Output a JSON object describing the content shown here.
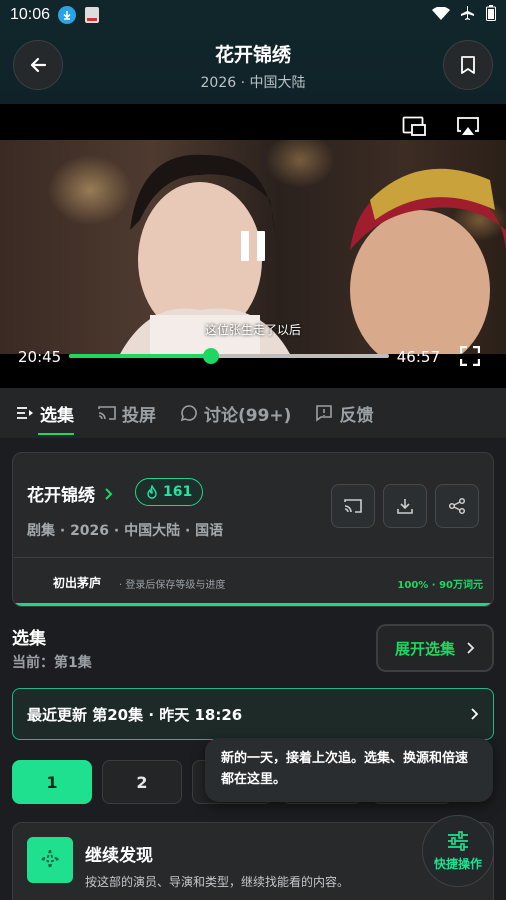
{
  "status_bar": {
    "time": "10:06"
  },
  "header": {
    "title": "花开锦绣",
    "subtitle": "2026 · 中国大陆"
  },
  "player": {
    "caption": "这位张生走了以后",
    "current_time": "20:45",
    "total_time": "46:57",
    "progress_fraction": 0.444,
    "accent_color": "#1ed760"
  },
  "tabs": [
    {
      "label": "选集",
      "icon": "episodes-icon",
      "active": true
    },
    {
      "label": "投屏",
      "icon": "cast-icon"
    },
    {
      "label": "讨论(99+)",
      "icon": "comment-icon"
    },
    {
      "label": "反馈",
      "icon": "feedback-icon"
    }
  ],
  "info": {
    "title": "花开锦绣",
    "heat": "161",
    "meta": "剧集 · 2026 · 中国大陆 · 国语",
    "level_name": "初出茅庐",
    "level_hint": "· 登录后保存等级与进度",
    "level_progress": "100% · 90万词元"
  },
  "episodes": {
    "section_title": "选集",
    "current": "当前：第1集",
    "expand_label": "展开选集",
    "latest_update": "最近更新 第20集 · 昨天 18:26",
    "items": [
      "1",
      "2",
      "",
      "",
      "",
      ""
    ]
  },
  "tooltip": {
    "text": "新的一天，接着上次追。选集、换源和倍速都在这里。"
  },
  "discover": {
    "title": "继续发现",
    "desc": "按这部的演员、导演和类型，继续找能看的内容。"
  },
  "fab": {
    "label": "快捷操作"
  }
}
